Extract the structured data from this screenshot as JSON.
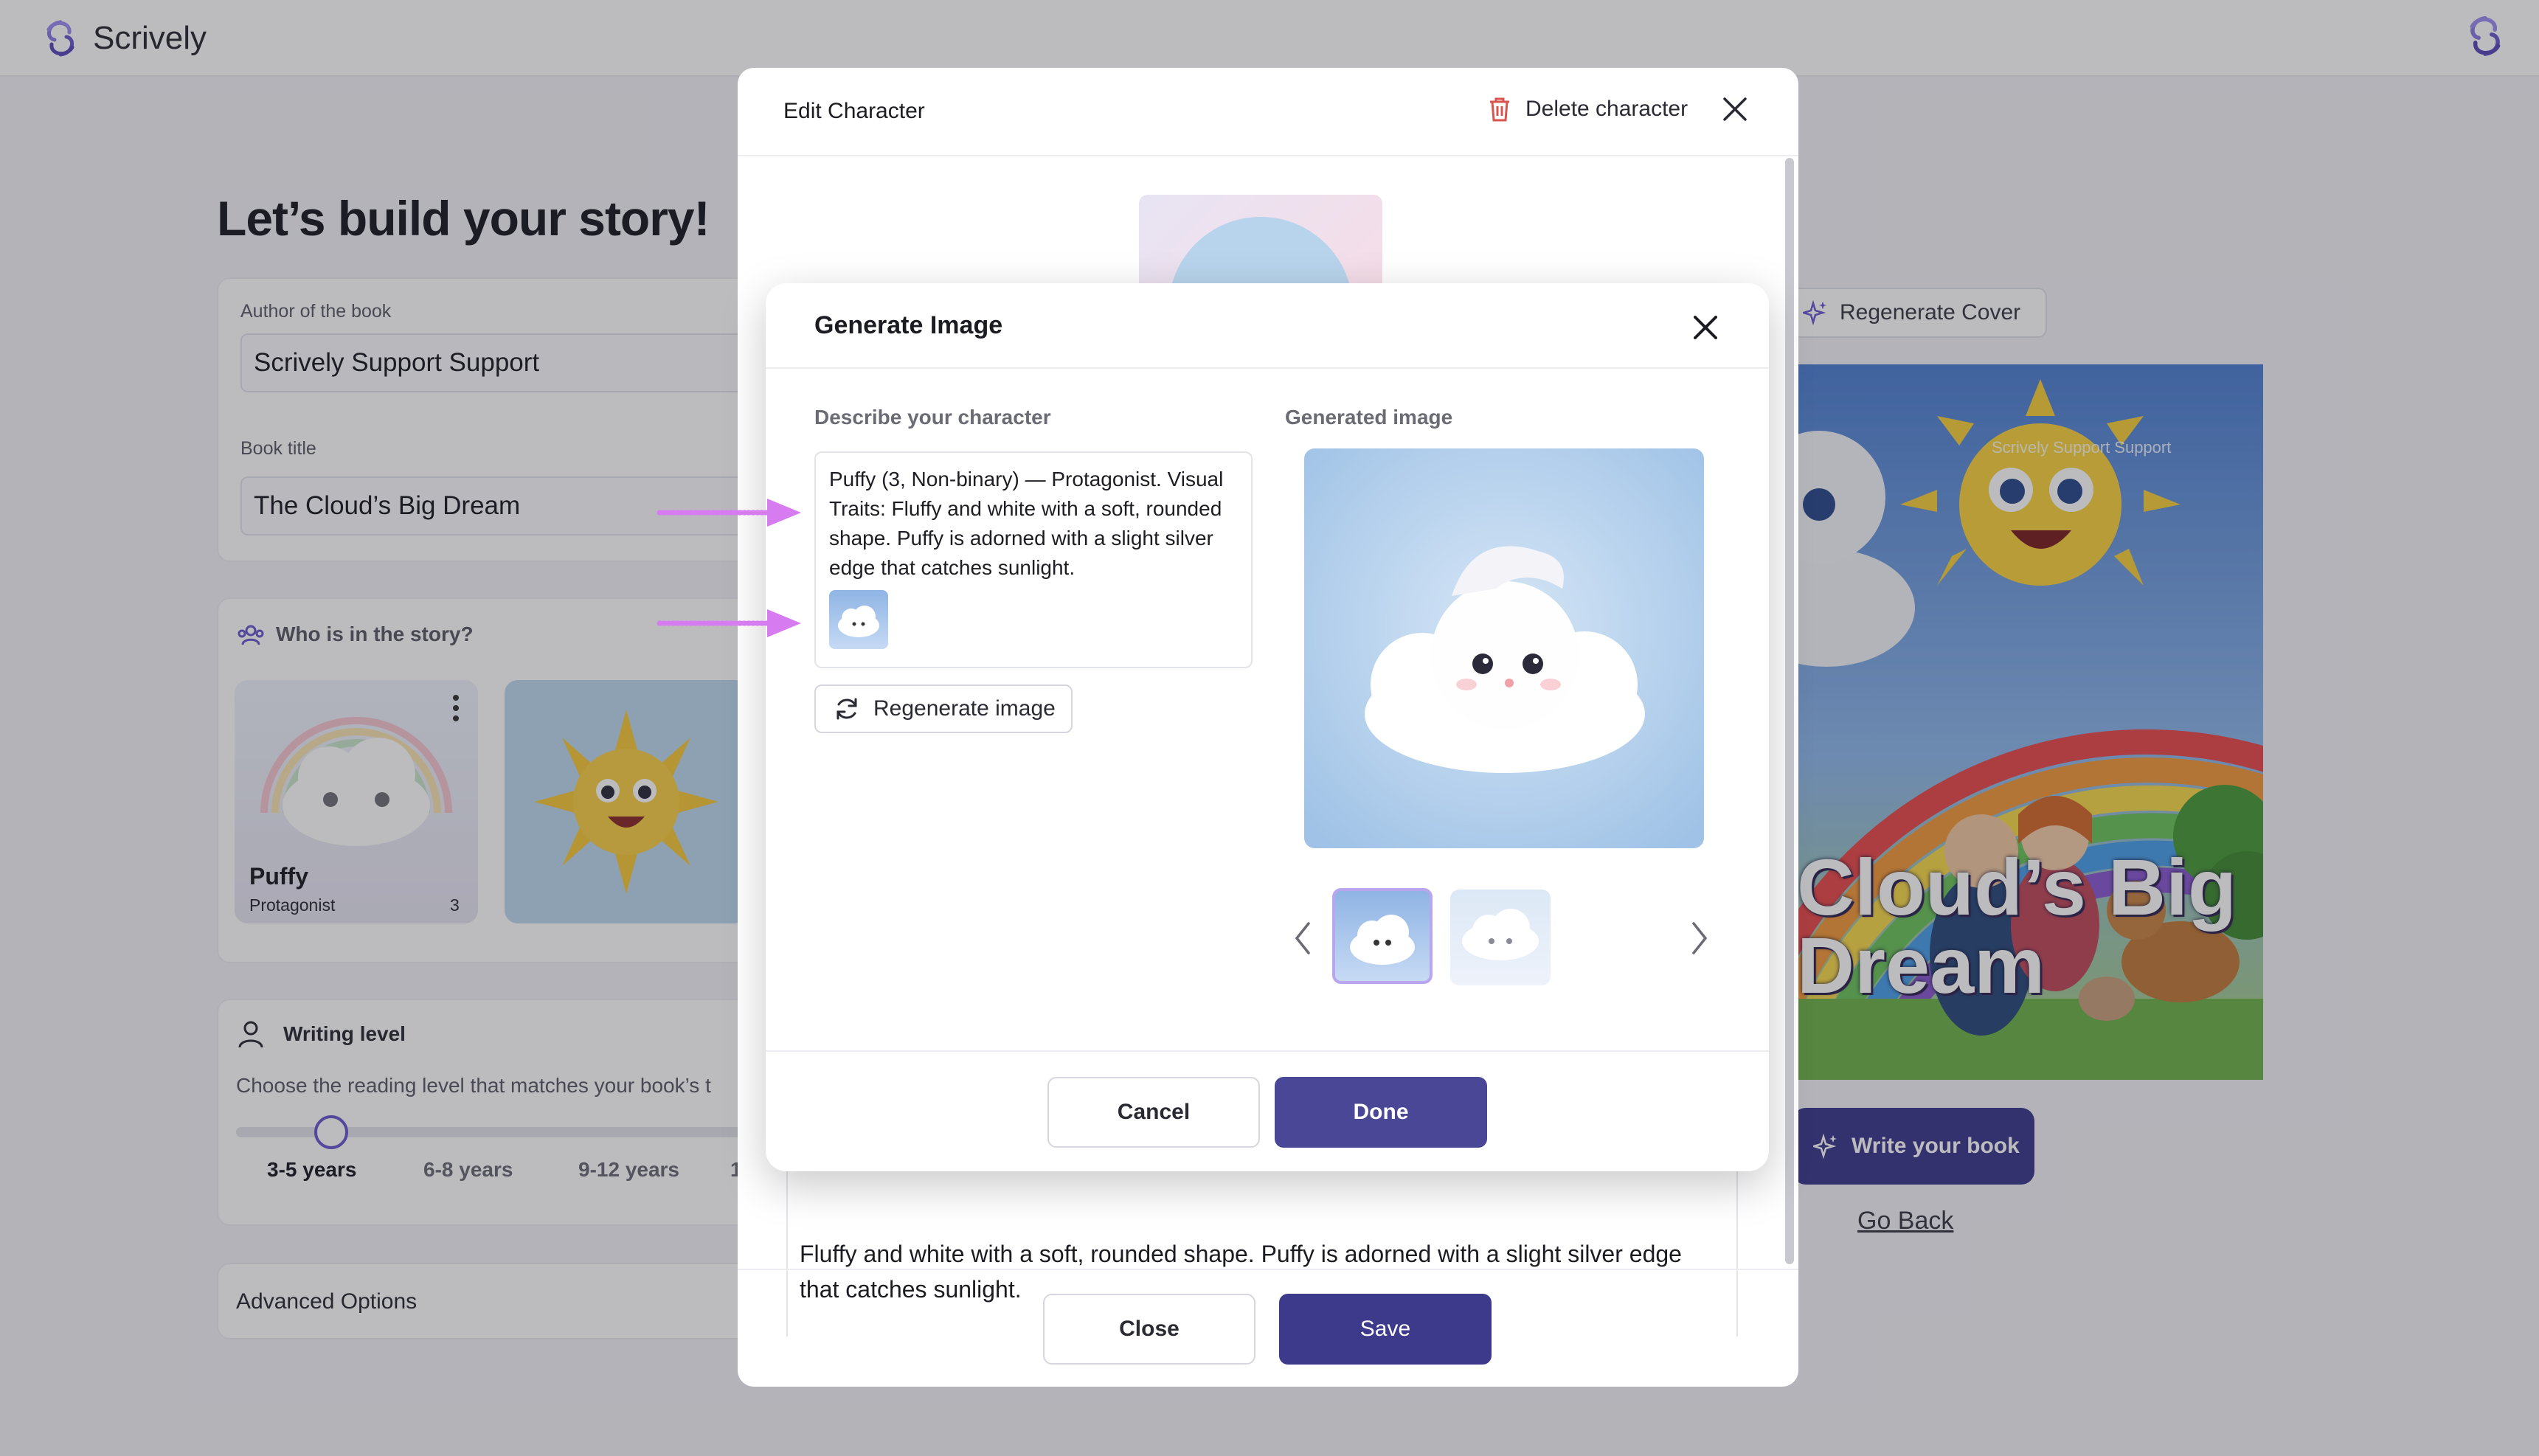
{
  "app": {
    "name": "Scrively"
  },
  "left": {
    "title": "Let’s build your story!",
    "author_label": "Author of the book",
    "author_value": "Scrively Support Support",
    "book_title_label": "Book title",
    "book_title_value": "The Cloud’s Big Dream",
    "characters_heading": "Who is in the story?",
    "characters": [
      {
        "name": "Puffy",
        "role": "Protagonist",
        "age": "3"
      }
    ],
    "writing_level_heading": "Writing level",
    "writing_level_desc": "Choose the reading level that matches your book’s t",
    "levels": [
      "3-5 years",
      "6-8 years",
      "9-12 years",
      "1"
    ],
    "level_value": 0,
    "advanced_options": "Advanced Options"
  },
  "cover": {
    "regenerate_label": "Regenerate Cover",
    "title_line1": "Cloud’s Big",
    "title_line2": "Dream",
    "author_overlay": "Scrively Support Support",
    "write_button": "Write your book",
    "go_back": "Go Back"
  },
  "edit_modal": {
    "title": "Edit Character",
    "delete_label": "Delete character",
    "description_line1": "Fluffy and white with a soft, rounded shape. Puffy is adorned with a slight silver edge",
    "description_line2": "that catches sunlight.",
    "close_label": "Close",
    "save_label": "Save"
  },
  "gen_modal": {
    "title": "Generate Image",
    "describe_label": "Describe your character",
    "description": "Puffy (3, Non-binary) — Protagonist. Visual Traits: Fluffy and white with a soft, rounded shape. Puffy is adorned with a slight silver edge that catches sunlight.",
    "regenerate_label": "Regenerate image",
    "generated_label": "Generated image",
    "cancel_label": "Cancel",
    "done_label": "Done"
  },
  "colors": {
    "primary": "#4a4796",
    "primary_dark": "#3d3a8c",
    "annotation_arrow": "#d77cf0",
    "delete_icon": "#d9534f"
  },
  "icons": [
    "scrively-logo",
    "trash-icon",
    "close-icon",
    "users-icon",
    "person-icon",
    "sparkle-icon",
    "refresh-icon",
    "chevron-left-icon",
    "chevron-right-icon",
    "kebab-icon"
  ]
}
